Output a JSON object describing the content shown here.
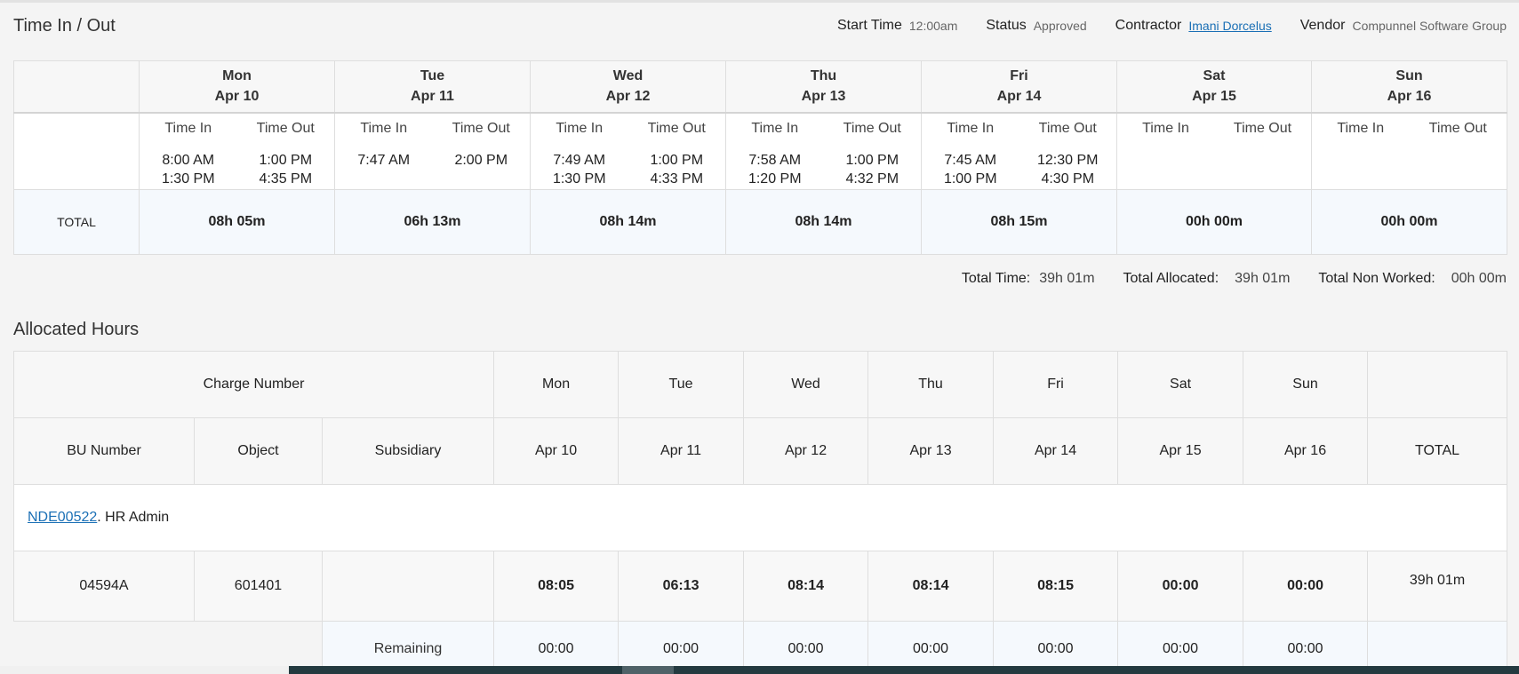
{
  "time_section": {
    "title": "Time In / Out",
    "meta": {
      "start_time_label": "Start Time",
      "start_time_value": "12:00am",
      "status_label": "Status",
      "status_value": "Approved",
      "contractor_label": "Contractor",
      "contractor_value": "Imani Dorcelus",
      "vendor_label": "Vendor",
      "vendor_value": "Compunnel Software Group"
    },
    "time_in_label": "Time In",
    "time_out_label": "Time Out",
    "total_label": "TOTAL",
    "days": [
      {
        "day": "Mon",
        "date": "Apr 10",
        "in": [
          "8:00 AM",
          "1:30 PM"
        ],
        "out": [
          "1:00 PM",
          "4:35 PM"
        ],
        "total": "08h 05m"
      },
      {
        "day": "Tue",
        "date": "Apr 11",
        "in": [
          "7:47 AM",
          ""
        ],
        "out": [
          "2:00 PM",
          ""
        ],
        "total": "06h 13m"
      },
      {
        "day": "Wed",
        "date": "Apr 12",
        "in": [
          "7:49 AM",
          "1:30 PM"
        ],
        "out": [
          "1:00 PM",
          "4:33 PM"
        ],
        "total": "08h 14m"
      },
      {
        "day": "Thu",
        "date": "Apr 13",
        "in": [
          "7:58 AM",
          "1:20 PM"
        ],
        "out": [
          "1:00 PM",
          "4:32 PM"
        ],
        "total": "08h 14m"
      },
      {
        "day": "Fri",
        "date": "Apr 14",
        "in": [
          "7:45 AM",
          "1:00 PM"
        ],
        "out": [
          "12:30 PM",
          "4:30 PM"
        ],
        "total": "08h 15m"
      },
      {
        "day": "Sat",
        "date": "Apr 15",
        "in": [
          "",
          ""
        ],
        "out": [
          "",
          ""
        ],
        "total": "00h 00m"
      },
      {
        "day": "Sun",
        "date": "Apr 16",
        "in": [
          "",
          ""
        ],
        "out": [
          "",
          ""
        ],
        "total": "00h 00m"
      }
    ],
    "totals": {
      "total_time_label": "Total Time:",
      "total_time_value": "39h 01m",
      "total_allocated_label": "Total Allocated:",
      "total_allocated_value": "39h 01m",
      "total_non_worked_label": "Total Non Worked:",
      "total_non_worked_value": "00h 00m"
    }
  },
  "alloc_section": {
    "title": "Allocated Hours",
    "charge_number_label": "Charge Number",
    "bu_number_label": "BU Number",
    "object_label": "Object",
    "subsidiary_label": "Subsidiary",
    "total_label": "TOTAL",
    "days": [
      {
        "day": "Mon",
        "date": "Apr 10"
      },
      {
        "day": "Tue",
        "date": "Apr 11"
      },
      {
        "day": "Wed",
        "date": "Apr 12"
      },
      {
        "day": "Thu",
        "date": "Apr 13"
      },
      {
        "day": "Fri",
        "date": "Apr 14"
      },
      {
        "day": "Sat",
        "date": "Apr 15"
      },
      {
        "day": "Sun",
        "date": "Apr 16"
      }
    ],
    "group": {
      "code": "NDE00522",
      "suffix": ". HR Admin"
    },
    "row": {
      "bu_number": "04594A",
      "object": "601401",
      "subsidiary": "",
      "hours": [
        "08:05",
        "06:13",
        "08:14",
        "08:14",
        "08:15",
        "00:00",
        "00:00"
      ],
      "total": "39h 01m"
    },
    "remaining": {
      "label": "Remaining",
      "hours": [
        "00:00",
        "00:00",
        "00:00",
        "00:00",
        "00:00",
        "00:00",
        "00:00"
      ]
    }
  }
}
